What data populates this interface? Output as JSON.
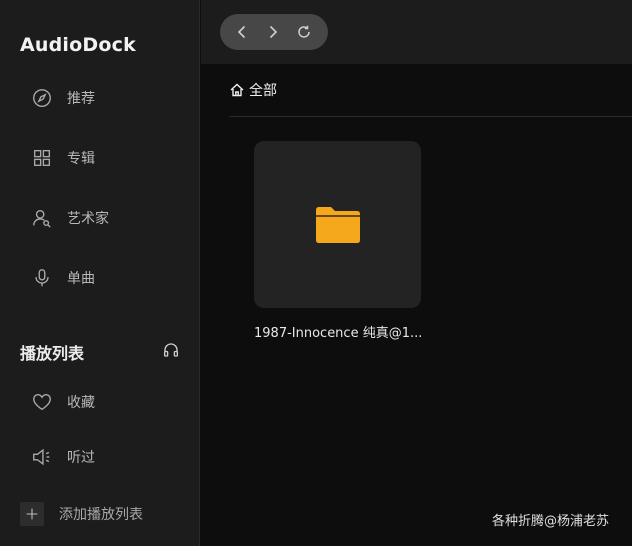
{
  "app": {
    "title": "AudioDock"
  },
  "sidebar": {
    "items": [
      {
        "label": "推荐",
        "icon": "compass-icon"
      },
      {
        "label": "专辑",
        "icon": "grid-icon"
      },
      {
        "label": "艺术家",
        "icon": "artist-icon"
      },
      {
        "label": "单曲",
        "icon": "microphone-icon"
      }
    ],
    "playlist_section": {
      "title": "播放列表",
      "icon": "headphones-icon",
      "items": [
        {
          "label": "收藏",
          "icon": "heart-icon"
        },
        {
          "label": "听过",
          "icon": "speaker-icon"
        }
      ],
      "add_label": "添加播放列表"
    }
  },
  "toolbar": {
    "back_icon": "chevron-left-icon",
    "forward_icon": "chevron-right-icon",
    "refresh_icon": "refresh-icon"
  },
  "content": {
    "breadcrumb": {
      "label": "全部",
      "icon": "home-icon"
    },
    "folders": [
      {
        "name": "1987-Innocence 纯真@1...",
        "icon": "folder-icon",
        "color": "#f5a81c"
      }
    ]
  },
  "watermark": "各种折腾@杨浦老苏",
  "colors": {
    "sidebar_bg": "#1c1c1c",
    "content_bg": "#0d0d0d",
    "tile_bg": "#232323",
    "folder": "#f5a81c",
    "pill_bg": "#474747"
  }
}
